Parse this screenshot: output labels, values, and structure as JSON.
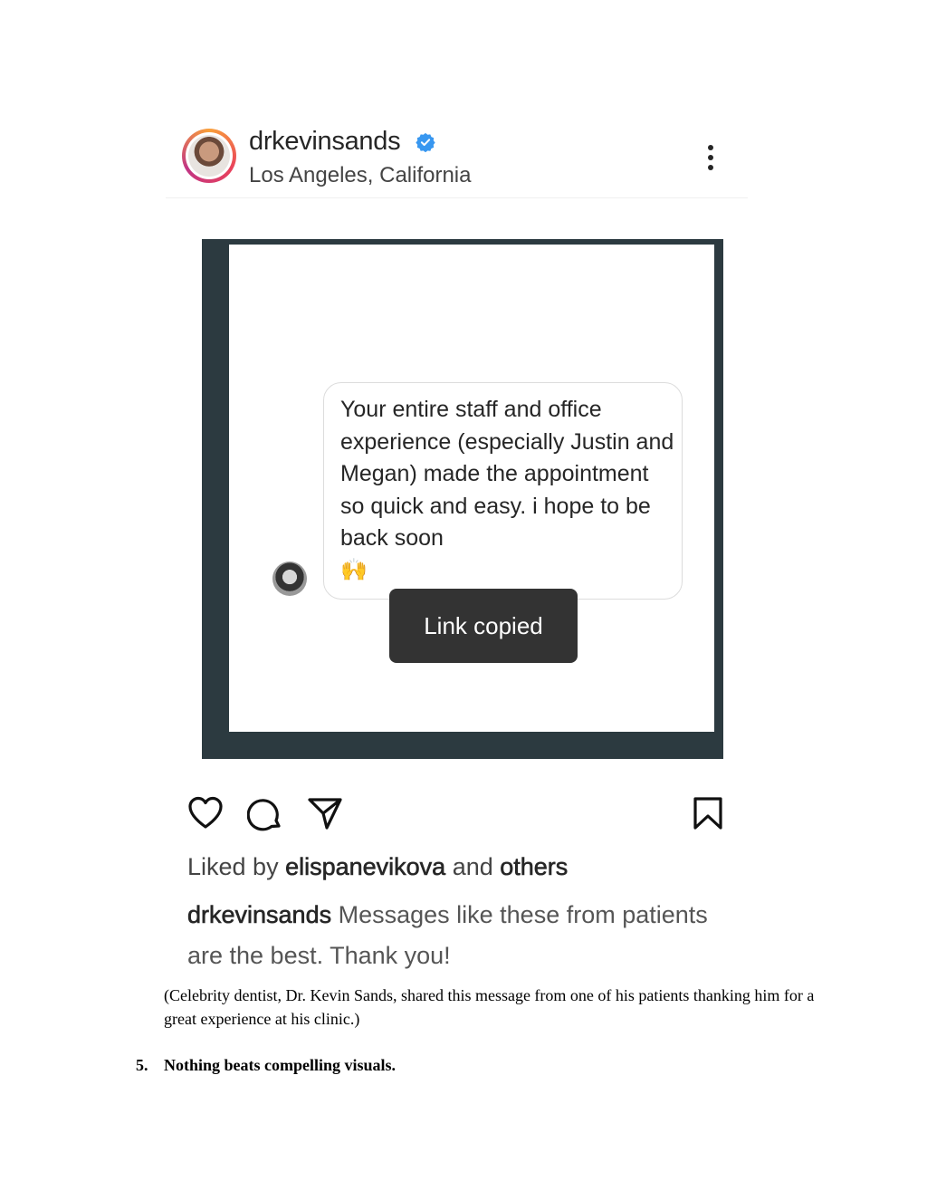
{
  "post": {
    "username": "drkevinsands",
    "location": "Los Angeles, California",
    "message_text": "Your entire staff and office experience (especially Justin and Megan) made the appointment so quick and easy. i hope to be back soon",
    "message_emoji": "🙌",
    "toast": "Link copied",
    "likes": {
      "prefix": "Liked by ",
      "user": "elispanevikova",
      "mid": " and ",
      "others": "others"
    },
    "caption": {
      "user": "drkevinsands",
      "text": " Messages like these from patients are the best. Thank you!"
    }
  },
  "document": {
    "image_caption": "(Celebrity dentist, Dr. Kevin Sands, shared this message from one of his patients thanking him for a great experience at his clinic.)",
    "heading_number": "5.",
    "heading_text": "Nothing beats compelling visuals."
  },
  "icons": [
    "verified-badge-icon",
    "more-icon",
    "heart-icon",
    "comment-icon",
    "share-icon",
    "bookmark-icon"
  ],
  "colors": {
    "verified": "#3897f0",
    "frame": "#2c3a40",
    "toast": "#333333"
  }
}
